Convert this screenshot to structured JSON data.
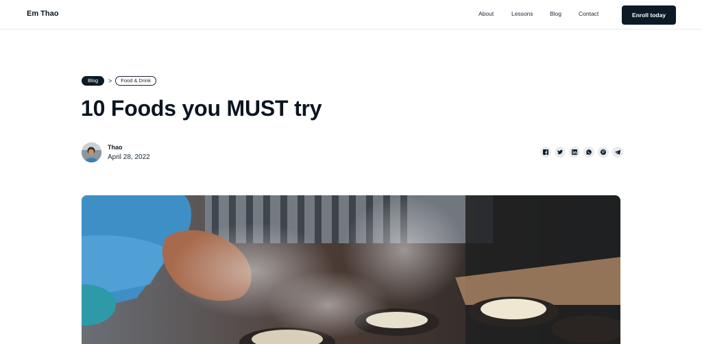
{
  "header": {
    "brand": "Em Thao",
    "nav": [
      "About",
      "Lessons",
      "Blog",
      "Contact"
    ],
    "cta_label": "Enroll today"
  },
  "breadcrumb": {
    "section": "Blog",
    "separator": ">",
    "category": "Food & Drink"
  },
  "post": {
    "title": "10 Foods you MUST try",
    "author": "Thao",
    "date": "April 28, 2022"
  },
  "share": {
    "icons": [
      "facebook-icon",
      "twitter-icon",
      "linkedin-icon",
      "whatsapp-icon",
      "pinterest-icon",
      "telegram-icon"
    ]
  },
  "colors": {
    "primary": "#0b1a26",
    "share_bg": "#e8eaed",
    "divider": "#ececec"
  }
}
